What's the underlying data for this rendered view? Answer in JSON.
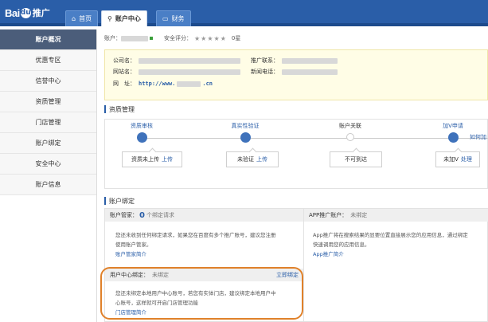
{
  "brand": {
    "logo_text": "Bai",
    "logo_paw": "du",
    "logo_suffix": "推广"
  },
  "tabs": [
    {
      "label": "首页",
      "icon": "home-icon",
      "glyph": "⌂"
    },
    {
      "label": "账户中心",
      "icon": "user-icon",
      "glyph": "👤"
    },
    {
      "label": "财务",
      "icon": "wallet-icon",
      "glyph": "▭"
    }
  ],
  "sidebar": {
    "items": [
      {
        "label": "账户概况",
        "active": true
      },
      {
        "label": "优惠专区"
      },
      {
        "label": "信誉中心"
      },
      {
        "label": "资质管理"
      },
      {
        "label": "门店管理"
      },
      {
        "label": "账户绑定"
      },
      {
        "label": "安全中心"
      },
      {
        "label": "账户信息"
      }
    ]
  },
  "account": {
    "account_label": "账户：",
    "security_label": "安全评分：",
    "stars": "★★★★★",
    "score": "0星"
  },
  "company": {
    "name_label": "公司名：",
    "site_label": "网站名：",
    "url_label": "网　址：",
    "url_prefix": "http://www.",
    "url_suffix": ".cn",
    "contact_label": "推广联系：",
    "phone_label": "新闻电话："
  },
  "qualification": {
    "title": "资质管理",
    "steps": [
      {
        "label": "资质审核",
        "state": "done",
        "status": "资质未上传",
        "action": "上传"
      },
      {
        "label": "真实性验证",
        "state": "done",
        "status": "未验证",
        "action": "上传"
      },
      {
        "label": "账户关联",
        "state": "pending",
        "status": "不可到达",
        "action": ""
      },
      {
        "label": "加V申请",
        "state": "done",
        "status": "未加V",
        "action": "处理"
      }
    ],
    "side_link": "如何加"
  },
  "binding": {
    "title": "账户绑定",
    "manager": {
      "label": "账户管家：",
      "count": "0",
      "count_suffix": "个绑定请求",
      "desc_line1": "您还未收到任何绑定请求，如果您在百度有多个推广账号，建议您注册",
      "desc_line2": "使用账户管家。",
      "link": "账户管家简介"
    },
    "app": {
      "label": "APP推广账户：",
      "status": "未绑定",
      "desc_line1": "App推广将在搜索结果的显要位置直接展示您的应用信息，通过绑定",
      "desc_line2": "快速调用您的应用信息。",
      "link": "App推广简介"
    },
    "user_center": {
      "label": "用户中心绑定：",
      "status": "未绑定",
      "action": "立即绑定",
      "desc_line1": "您还未绑定本地用户中心账号，若您有实体门店，建议绑定本地用户中",
      "desc_line2": "心账号，这样就可开启门店管理功能",
      "link": "门店管理简介"
    }
  },
  "colors": {
    "brand_blue": "#2a5ea8",
    "highlight": "#e0812a",
    "sidebar_active": "#4b5d7a"
  }
}
